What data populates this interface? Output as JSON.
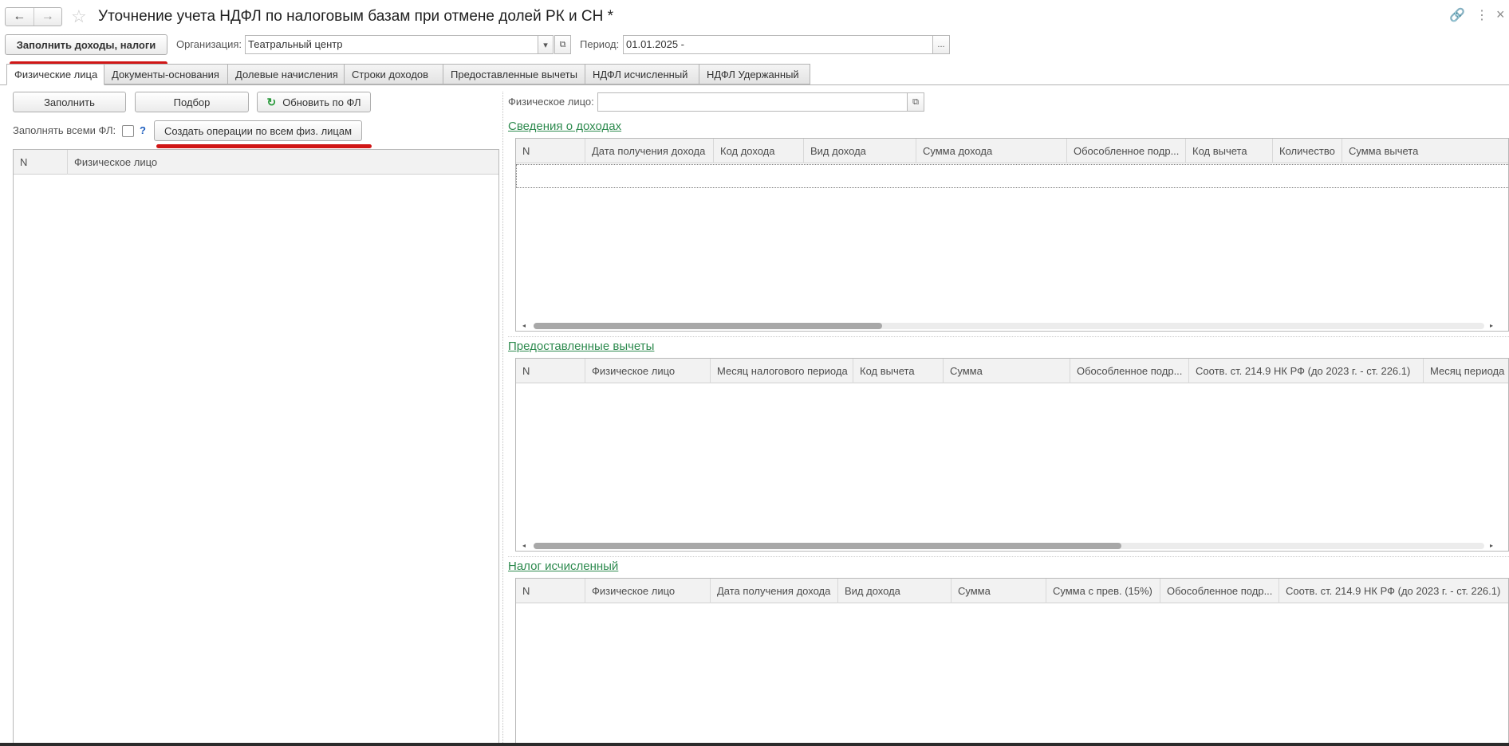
{
  "header": {
    "title": "Уточнение учета НДФЛ по налоговым базам при отмене долей РК и СН *",
    "back_icon": "←",
    "forward_icon": "→",
    "favorite_icon": "☆",
    "link_icon": "🔗",
    "more_icon": "⋮",
    "close_icon": "×"
  },
  "toolbar": {
    "fill_button": "Заполнить доходы, налоги",
    "org_label": "Организация:",
    "org_value": "Театральный центр",
    "dropdown_icon": "▾",
    "open_icon": "⧉",
    "period_label": "Период:",
    "period_value": "01.01.2025 -",
    "period_select": "..."
  },
  "tabs": [
    "Физические лица",
    "Документы-основания",
    "Долевые начисления",
    "Строки доходов",
    "Предоставленные вычеты",
    "НДФЛ исчисленный",
    "НДФЛ Удержанный"
  ],
  "left_panel": {
    "fill_btn": "Заполнить",
    "pick_btn": "Подбор",
    "refresh_btn": "Обновить по ФЛ",
    "refresh_icon": "↻",
    "fill_all_label": "Заполнять всеми ФЛ:",
    "help": "?",
    "create_ops_btn": "Создать операции по всем физ. лицам",
    "columns": [
      "N",
      "Физическое лицо"
    ]
  },
  "right_panel": {
    "person_label": "Физическое лицо:",
    "person_value": "",
    "open_icon": "⧉",
    "income": {
      "title": "Сведения о доходах",
      "columns": [
        "N",
        "Дата получения дохода",
        "Код дохода",
        "Вид дохода",
        "Сумма дохода",
        "Обособленное подр...",
        "Код вычета",
        "Количество",
        "Сумма вычета"
      ],
      "scroll": {
        "left": "◂",
        "right": "▸"
      }
    },
    "deductions": {
      "title": "Предоставленные вычеты",
      "columns": [
        "N",
        "Физическое лицо",
        "Месяц налогового периода",
        "Код вычета",
        "Сумма",
        "Обособленное подр...",
        "Соотв. ст. 214.9 НК РФ (до 2023 г. - ст. 226.1)",
        "Месяц периода"
      ],
      "scroll": {
        "left": "◂",
        "right": "▸"
      }
    },
    "tax": {
      "title": "Налог исчисленный",
      "columns": [
        "N",
        "Физическое лицо",
        "Дата получения дохода",
        "Вид дохода",
        "Сумма",
        "Сумма с прев. (15%)",
        "Обособленное подр...",
        "Соотв. ст. 214.9 НК РФ (до 2023 г. - ст. 226.1)"
      ]
    }
  },
  "colors": {
    "section_link": "#2d8a4e",
    "annotation": "#d01616",
    "help": "#1f5fbf"
  }
}
